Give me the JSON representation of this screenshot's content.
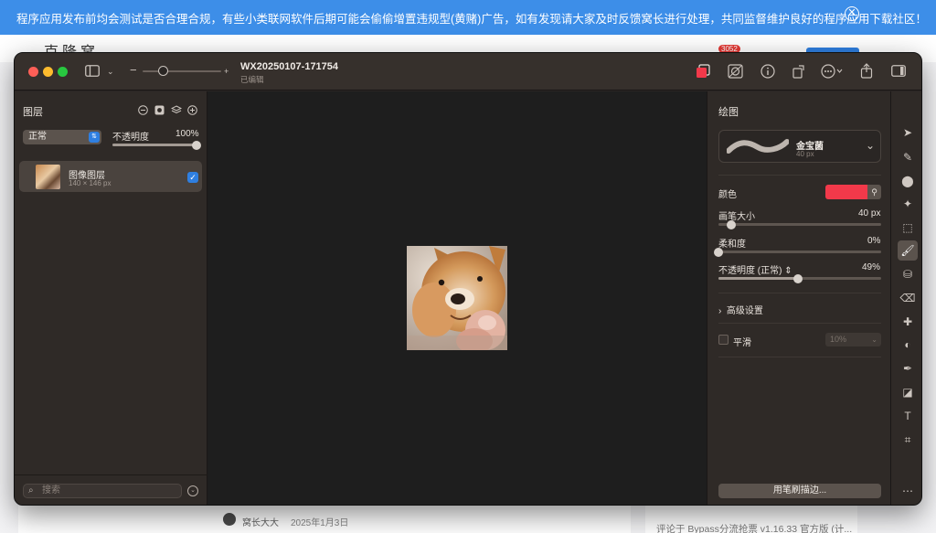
{
  "background_page": {
    "notice_text": "程序应用发布前均会测试是否合理合规，有些小类联网软件后期可能会偷偷增置违规型(黄赌)广告，如有发现请大家及时反馈窝长进行处理，共同监督维护良好的程序应用下载社区！",
    "notice_close_icon": "close-circle-icon",
    "site_logo": "克隆窝",
    "badge": "3052",
    "author": "窝长大大",
    "date": "2025年1月3日",
    "comment_snippet": "评论于 Bypass分流抢票 v1.16.33 官方版 (计..."
  },
  "window": {
    "title": "WX20250107-171754",
    "subtitle": "已编辑",
    "zoom": {
      "min_label": "−",
      "max_label": "+",
      "level": 0.25
    },
    "toolbar_icons": [
      "sidebar-icon",
      "chevron-down-icon",
      "color-stroke-icon",
      "mask-icon",
      "info-icon",
      "rotate-icon",
      "more-icon",
      "share-icon",
      "inspector-icon"
    ]
  },
  "layers_panel": {
    "title": "图层",
    "header_icons": [
      "minus-circle-icon",
      "mask-square-icon",
      "layers-stack-icon",
      "plus-circle-icon"
    ],
    "blend_mode": "正常",
    "opacity_label": "不透明度",
    "opacity_value": "100%",
    "opacity_level": 1.0,
    "layers": [
      {
        "name": "图像图层",
        "size": "140 × 146 px",
        "visible": true
      }
    ],
    "search_placeholder": "搜索"
  },
  "inspector_panel": {
    "title": "绘图",
    "brush": {
      "name": "金宝菌",
      "size_label": "40 px"
    },
    "color_label": "颜色",
    "color_value": "#f2394a",
    "brush_size_label": "画笔大小",
    "brush_size_value": "40 px",
    "brush_size_level": 0.08,
    "softness_label": "柔和度",
    "softness_value": "0%",
    "softness_level": 0.0,
    "opacity_label": "不透明度 (正常)",
    "opacity_value": "49%",
    "opacity_level": 0.49,
    "advanced_label": "高级设置",
    "smooth_label": "平滑",
    "smooth_value": "10%",
    "stroke_button": "用笔刷描边..."
  },
  "tools": [
    "arrow-select-icon",
    "paint-selection-icon",
    "color-select-icon",
    "magic-wand-icon",
    "rect-select-icon",
    "paintbrush-icon",
    "bucket-icon",
    "eraser-icon",
    "bandage-icon",
    "clone-icon",
    "pen-icon",
    "shapes-icon",
    "text-icon",
    "crop-icon",
    "more-tools-icon"
  ]
}
